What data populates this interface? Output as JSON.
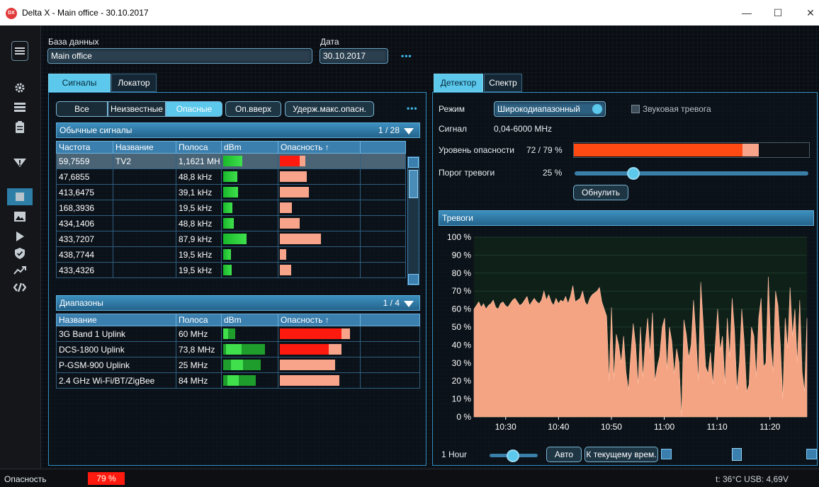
{
  "window": {
    "title": "Delta X - Main office - 30.10.2017",
    "app_icon_text": "DX",
    "min": "—",
    "max": "☐",
    "close": "✕"
  },
  "header": {
    "db_label": "База данных",
    "db_value": "Main office",
    "date_label": "Дата",
    "date_value": "30.10.2017",
    "more": "•••"
  },
  "left_tabs": [
    "Сигналы",
    "Локатор"
  ],
  "filters": {
    "all": "Все",
    "unknown": "Неизвестные",
    "dangerous": "Опасные",
    "up": "Оп.вверх",
    "hold": "Удерж.макс.опасн.",
    "more": "•••"
  },
  "signals": {
    "title": "Обычные сигналы",
    "count": "1 / 28",
    "columns": [
      "Частота",
      "Название",
      "Полоса",
      "dBm",
      "Опасность ↑",
      ""
    ],
    "rows": [
      {
        "freq": "59,7559",
        "name": "TV2",
        "band": "1,1621 MH",
        "dbm": 0.35,
        "danger_red": 0.25,
        "danger": 0.32,
        "selected": true
      },
      {
        "freq": "47,6855",
        "name": "",
        "band": "48,8 kHz",
        "dbm": 0.26,
        "danger_red": 0,
        "danger": 0.34
      },
      {
        "freq": "413,6475",
        "name": "",
        "band": "39,1 kHz",
        "dbm": 0.27,
        "danger_red": 0,
        "danger": 0.37
      },
      {
        "freq": "168,3936",
        "name": "",
        "band": "19,5 kHz",
        "dbm": 0.17,
        "danger_red": 0,
        "danger": 0.15
      },
      {
        "freq": "434,1406",
        "name": "",
        "band": "48,8 kHz",
        "dbm": 0.2,
        "danger_red": 0,
        "danger": 0.25
      },
      {
        "freq": "433,7207",
        "name": "",
        "band": "87,9 kHz",
        "dbm": 0.43,
        "danger_red": 0,
        "danger": 0.52
      },
      {
        "freq": "438,7744",
        "name": "",
        "band": "19,5 kHz",
        "dbm": 0.15,
        "danger_red": 0,
        "danger": 0.08
      },
      {
        "freq": "433,4326",
        "name": "",
        "band": "19,5 kHz",
        "dbm": 0.16,
        "danger_red": 0,
        "danger": 0.14
      }
    ]
  },
  "ranges": {
    "title": "Диапазоны",
    "count": "1 / 4",
    "columns": [
      "Название",
      "Полоса",
      "dBm",
      "Опасность ↑",
      ""
    ],
    "rows": [
      {
        "name": "3G Band 1 Uplink",
        "band": "60 MHz",
        "dbm_lo": 0.0,
        "dbm_hi": 0.22,
        "danger_red": 0.78,
        "danger": 0.88
      },
      {
        "name": "DCS-1800 Uplink",
        "band": "73,8 MHz",
        "dbm_lo": 0.05,
        "dbm_hi": 0.77,
        "danger_red": 0.62,
        "danger": 0.78
      },
      {
        "name": "P-GSM-900 Uplink",
        "band": "25 MHz",
        "dbm_lo": 0.15,
        "dbm_hi": 0.7,
        "danger_red": 0,
        "danger": 0.7
      },
      {
        "name": "2.4 GHz Wi-Fi/BT/ZigBee",
        "band": "84 MHz",
        "dbm_lo": 0.08,
        "dbm_hi": 0.6,
        "danger_red": 0,
        "danger": 0.75
      }
    ]
  },
  "right_tabs": [
    "Детектор",
    "Спектр"
  ],
  "detector": {
    "mode_label": "Режим",
    "mode_value": "Широкодиапазонный",
    "sound_label": "Звуковая тревога",
    "signal_label": "Сигнал",
    "signal_value": "0,04-6000 MHz",
    "danger_label": "Уровень опасности",
    "danger_value": "72 / 79 %",
    "danger_level": 0.72,
    "danger_max": 0.79,
    "threshold_label": "Порог тревоги",
    "threshold_value": "25 %",
    "threshold": 0.25,
    "reset": "Обнулить"
  },
  "alarms": {
    "title": "Тревоги",
    "range_label": "1 Hour",
    "auto": "Авто",
    "current": "К текущему врем."
  },
  "chart_data": {
    "type": "area",
    "title": "Тревоги",
    "ylim": [
      0,
      100
    ],
    "y_ticks": [
      "0 %",
      "10 %",
      "20 %",
      "30 %",
      "40 %",
      "50 %",
      "60 %",
      "70 %",
      "80 %",
      "90 %",
      "100 %"
    ],
    "x_ticks": [
      "10:30",
      "10:40",
      "10:50",
      "11:00",
      "11:10",
      "11:20"
    ],
    "xlim": [
      "10:24",
      "11:27"
    ],
    "series": [
      {
        "values": [
          60,
          62,
          64,
          61,
          63,
          60,
          62,
          63,
          65,
          61,
          60,
          63,
          64,
          62,
          61,
          63,
          65,
          66,
          64,
          62,
          63,
          65,
          67,
          62,
          64,
          66,
          64,
          63,
          65,
          70,
          65,
          68,
          64,
          62,
          66,
          63,
          65,
          64,
          67,
          63,
          67,
          73,
          64,
          65,
          66,
          70,
          64,
          62,
          66,
          68,
          69,
          70,
          72,
          64,
          60,
          56,
          20,
          61,
          21,
          46,
          40,
          30,
          45,
          25,
          15,
          35,
          52,
          40,
          18,
          50,
          22,
          41,
          55,
          35,
          58,
          20,
          28,
          34,
          50,
          55,
          26,
          50,
          42,
          24,
          38,
          30,
          0,
          54,
          46,
          33,
          40,
          65,
          45,
          20,
          75,
          52,
          28,
          24,
          36,
          18,
          40,
          60,
          37,
          45,
          18,
          55,
          33,
          66,
          48,
          15,
          30,
          60,
          42,
          14,
          18,
          50,
          45,
          22,
          55,
          66,
          28,
          30,
          78,
          40,
          25,
          70,
          62,
          40,
          10,
          55,
          38,
          72,
          45,
          60,
          30,
          65,
          25,
          14,
          55
        ]
      }
    ],
    "color": "#f4a482",
    "grid": true
  },
  "status": {
    "danger_label": "Опасность",
    "danger_value": "79 %",
    "system": "t: 36°C  USB: 4,69V"
  }
}
